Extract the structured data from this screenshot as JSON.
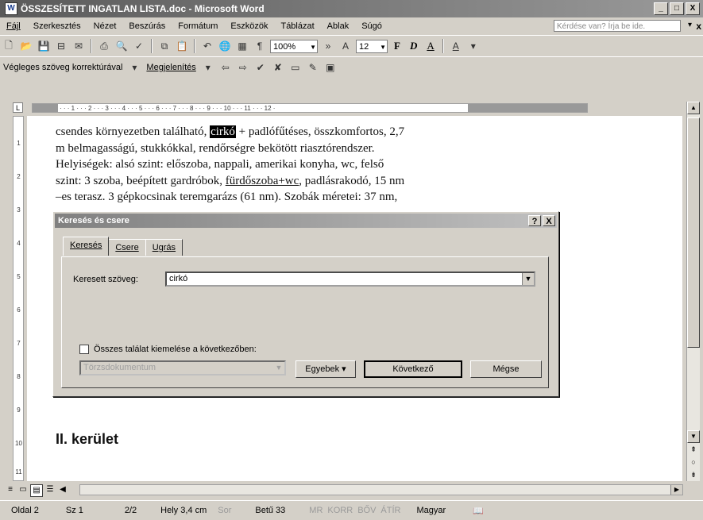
{
  "window": {
    "title": "ÖSSZESÍTETT INGATLAN LISTA.doc - Microsoft Word",
    "min": "_",
    "max": "□",
    "close": "X"
  },
  "menu": {
    "items": [
      "Fájl",
      "Szerkesztés",
      "Nézet",
      "Beszúrás",
      "Formátum",
      "Eszközök",
      "Táblázat",
      "Ablak",
      "Súgó"
    ],
    "help_placeholder": "Kérdése van? Írja be ide.",
    "close": "x"
  },
  "toolbar": {
    "zoom": "100%",
    "font_size": "12",
    "bold": "F",
    "italic": "D",
    "underline": "A",
    "para_mark": "¶"
  },
  "review_toolbar": {
    "mode": "Végleges szöveg korrektúrával",
    "show": "Megjelenítés"
  },
  "document": {
    "lines": [
      [
        "csendes környezetben található, ",
        "cirkó",
        " + padlófűtéses, összkomfortos, 2,7"
      ],
      [
        "m belmagasságú, stukkókkal, rendőrségre bekötött riasztórendszer."
      ],
      [
        "Helyiségek: alsó szint: előszoba, nappali, amerikai konyha, wc, felső"
      ],
      [
        "szint: 3 szoba, beépített gardróbok, ",
        "fürdőszoba+wc",
        ", padlásrakodó, 15 nm"
      ],
      [
        "–es terasz. 3 gépkocsinak teremgarázs (61 nm). Szobák méretei: 37 nm,"
      ]
    ],
    "heading": "II. kerület"
  },
  "dialog": {
    "title": "Keresés és csere",
    "help": "?",
    "close": "X",
    "tabs": [
      "Keresés",
      "Csere",
      "Ugrás"
    ],
    "find_label": "Keresett szöveg:",
    "find_value": "cirkó",
    "highlight_label": "Összes találat kiemelése a következőben:",
    "scope_value": "Törzsdokumentum",
    "more_button": "Egyebek ▾",
    "next_button": "Következő",
    "cancel_button": "Mégse"
  },
  "status": {
    "page": "Oldal 2",
    "section": "Sz 1",
    "pages": "2/2",
    "position": "Hely 3,4 cm",
    "line": "Sor",
    "column": "Betű 33",
    "rec": "MR",
    "trk": "KORR",
    "ext": "BŐV",
    "ovr": "ÁTÍR",
    "language": "Magyar"
  }
}
